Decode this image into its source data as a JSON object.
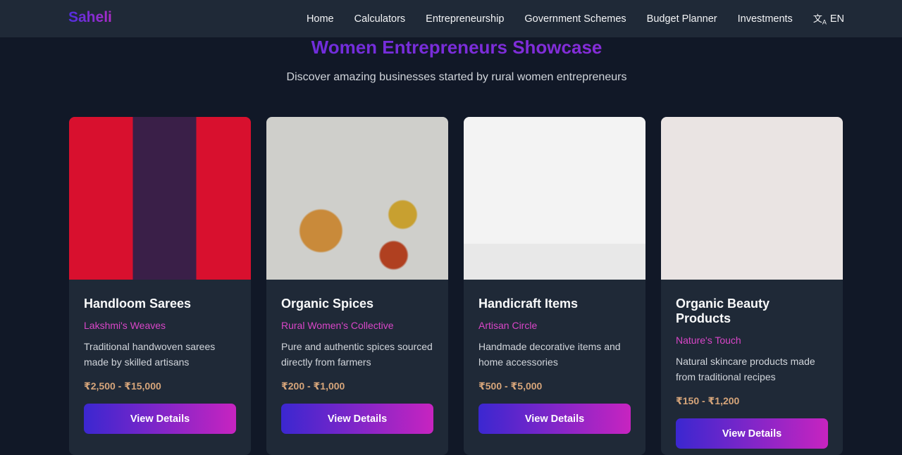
{
  "brand": "Saheli",
  "nav": {
    "items": [
      "Home",
      "Calculators",
      "Entrepreneurship",
      "Government Schemes",
      "Budget Planner",
      "Investments"
    ],
    "language": "EN"
  },
  "hero": {
    "title": "Women Entrepreneurs Showcase",
    "subtitle": "Discover amazing businesses started by rural women entrepreneurs"
  },
  "cards": [
    {
      "title": "Handloom Sarees",
      "maker": "Lakshmi's Weaves",
      "description": "Traditional handwoven sarees made by skilled artisans",
      "price": "₹2,500 - ₹15,000",
      "button": "View Details"
    },
    {
      "title": "Organic Spices",
      "maker": "Rural Women's Collective",
      "description": "Pure and authentic spices sourced directly from farmers",
      "price": "₹200 - ₹1,000",
      "button": "View Details"
    },
    {
      "title": "Handicraft Items",
      "maker": "Artisan Circle",
      "description": "Handmade decorative items and home accessories",
      "price": "₹500 - ₹5,000",
      "button": "View Details"
    },
    {
      "title": "Organic Beauty Products",
      "maker": "Nature's Touch",
      "description": "Natural skincare products made from traditional recipes",
      "price": "₹150 - ₹1,200",
      "button": "View Details"
    }
  ]
}
